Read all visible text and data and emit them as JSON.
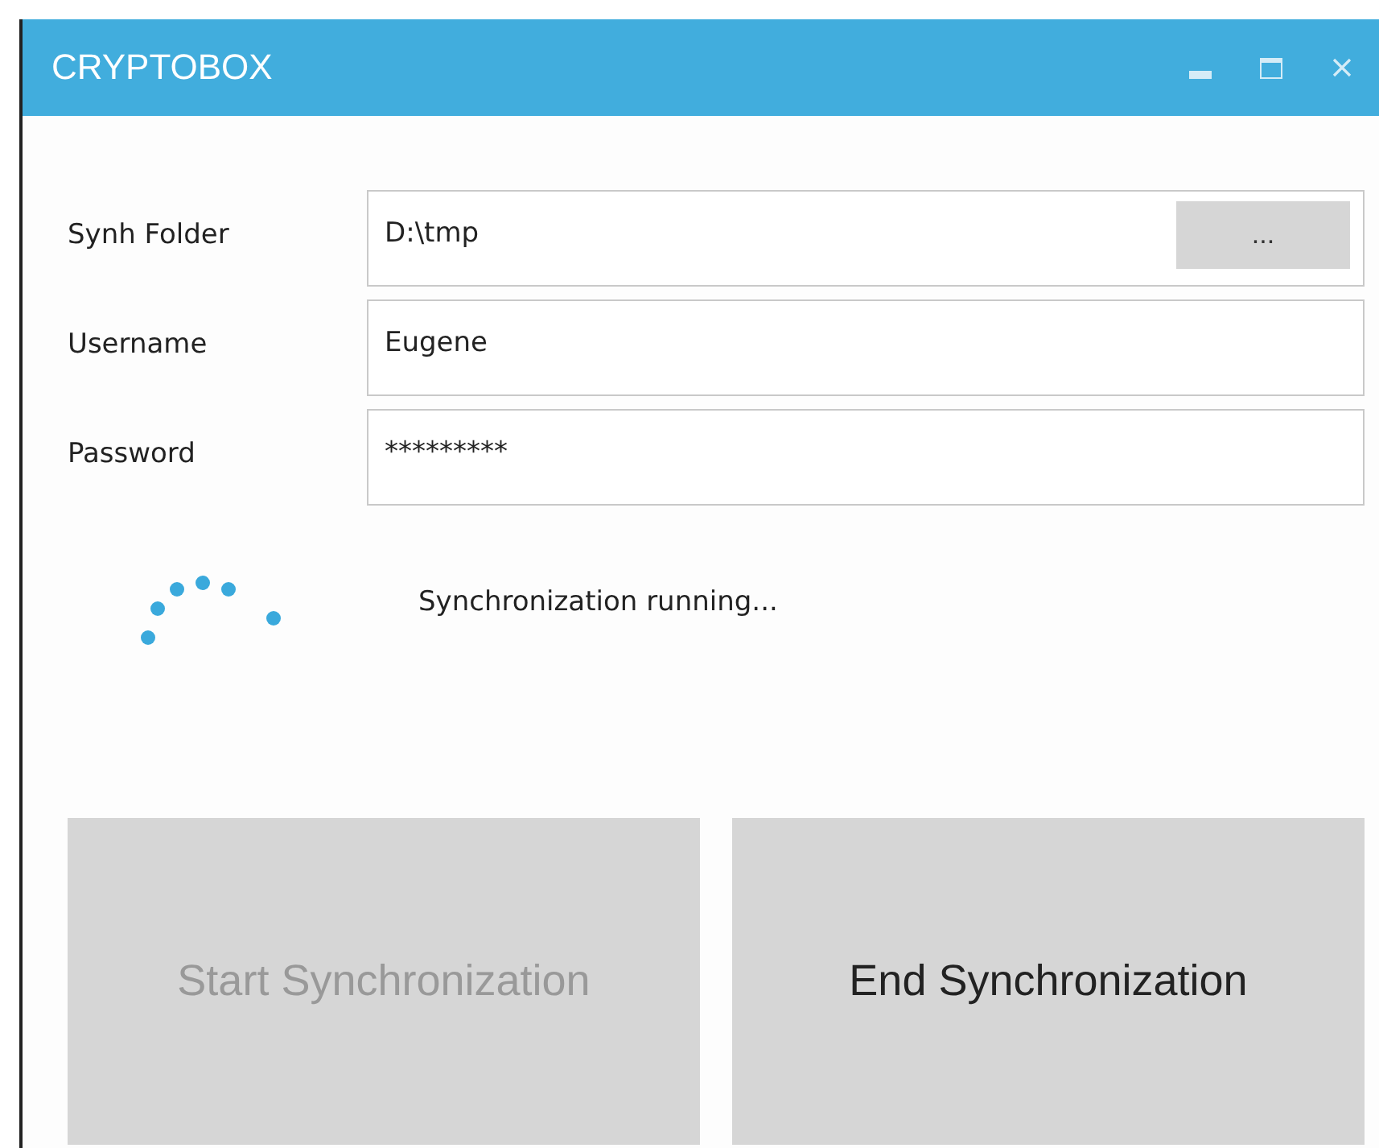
{
  "window": {
    "title": "CRYPTOBOX"
  },
  "fields": [
    {
      "label": "Synh Folder",
      "value": "D:\\tmp",
      "browse": "..."
    },
    {
      "label": "Username",
      "value": "Eugene"
    },
    {
      "label": "Password",
      "value": "*********"
    }
  ],
  "status": {
    "text": "Synchronization running...",
    "busy": true
  },
  "buttons": [
    {
      "label": "Start Synchronization",
      "disabled": true
    },
    {
      "label": "End Synchronization",
      "disabled": false
    }
  ]
}
